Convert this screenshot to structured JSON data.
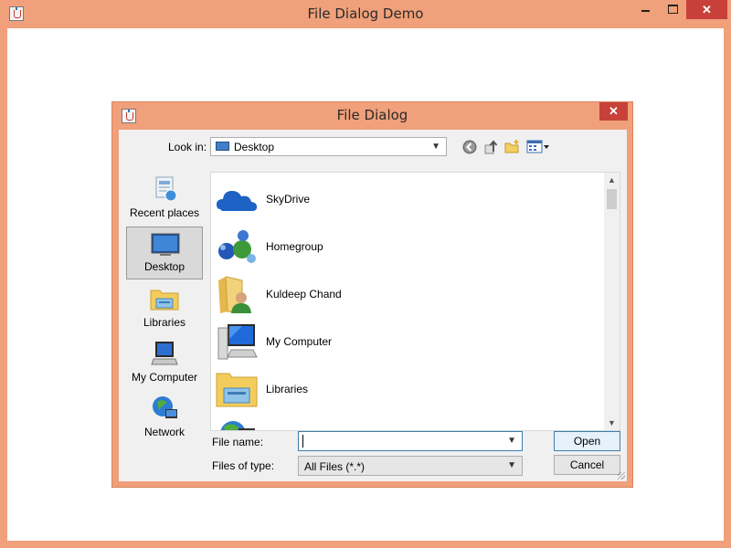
{
  "window": {
    "title": "File Dialog Demo"
  },
  "dialog": {
    "title": "File Dialog",
    "look_in_label": "Look in:",
    "look_in_value": "Desktop",
    "toolbar_icons": [
      "back-icon",
      "up-one-level-icon",
      "new-folder-icon",
      "view-menu-icon"
    ],
    "places": [
      {
        "label": "Recent places",
        "icon": "recent-places-icon"
      },
      {
        "label": "Desktop",
        "icon": "desktop-icon",
        "selected": true
      },
      {
        "label": "Libraries",
        "icon": "libraries-icon"
      },
      {
        "label": "My Computer",
        "icon": "my-computer-icon"
      },
      {
        "label": "Network",
        "icon": "network-icon"
      }
    ],
    "files": [
      {
        "name": "SkyDrive",
        "icon": "skydrive-icon"
      },
      {
        "name": "Homegroup",
        "icon": "homegroup-icon"
      },
      {
        "name": "Kuldeep Chand",
        "icon": "user-folder-icon"
      },
      {
        "name": "My Computer",
        "icon": "computer-icon"
      },
      {
        "name": "Libraries",
        "icon": "libraries-folder-icon"
      },
      {
        "name": "",
        "icon": "network-globe-icon"
      }
    ],
    "file_name_label": "File name:",
    "file_name_value": "",
    "file_type_label": "Files of type:",
    "file_type_value": "All Files (*.*)",
    "open_label": "Open",
    "cancel_label": "Cancel"
  },
  "colors": {
    "frame": "#f0a07a",
    "close_button": "#c7413a",
    "selection_border": "#3c7fb1"
  }
}
